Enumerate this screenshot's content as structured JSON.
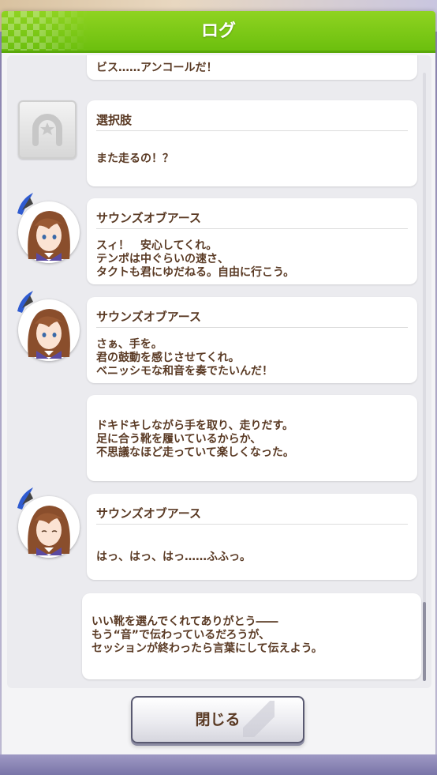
{
  "dialog": {
    "title": "ログ",
    "close_label": "閉じる"
  },
  "log": [
    {
      "speaker": "",
      "text": "ビス……アンコールだ！"
    },
    {
      "speaker": "選択肢",
      "text": "また走るの！？"
    },
    {
      "speaker": "サウンズオブアース",
      "text": "スィ！　安心してくれ。\nテンポは中ぐらいの速さ、\nタクトも君にゆだねる。自由に行こう。"
    },
    {
      "speaker": "サウンズオブアース",
      "text": "さぁ、手を。\n君の鼓動を感じさせてくれ。\nベニッシモな和音を奏でたいんだ！"
    },
    {
      "speaker": "",
      "text": "ドキドキしながら手を取り、走りだす。\n足に合う靴を履いているからか、\n不思議なほど走っていて楽しくなった。"
    },
    {
      "speaker": "サウンズオブアース",
      "text": "はっ、はっ、はっ……ふふっ。"
    },
    {
      "speaker": "",
      "text": "いい靴を選んでくれてありがとう――\nもう“音”で伝わっているだろうが、\nセッションが終わったら言葉にして伝えよう。"
    }
  ],
  "colors": {
    "title_bar": "#7ac70e",
    "text": "#5a3a24",
    "bubble": "#ffffff",
    "panel": "#ebebef"
  }
}
